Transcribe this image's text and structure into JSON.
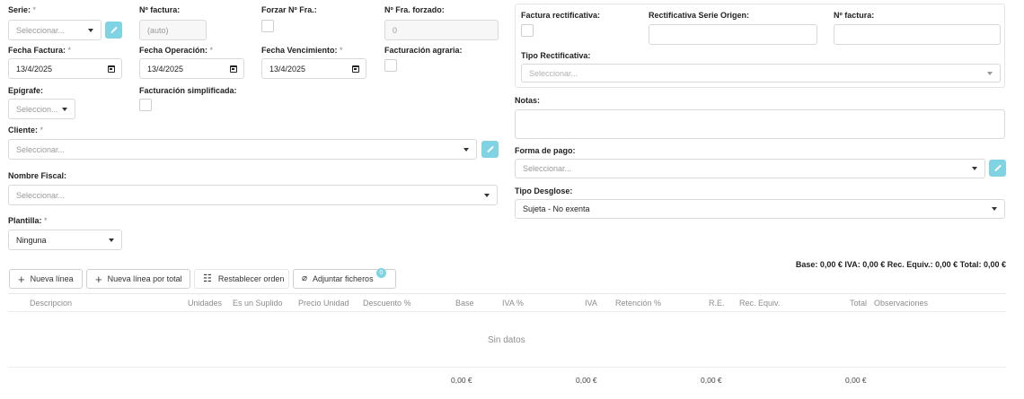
{
  "form": {
    "serie": {
      "label": "Serie:",
      "required": "*",
      "placeholder": "Seleccionar..."
    },
    "numero_factura": {
      "label": "Nº factura:",
      "value": "(auto)"
    },
    "forzar_nfra": {
      "label": "Forzar Nº Fra.:"
    },
    "nfra_forzado": {
      "label": "Nº Fra. forzado:",
      "value": "0"
    },
    "fecha_factura": {
      "label": "Fecha Factura:",
      "required": "*",
      "value": "13/4/2025"
    },
    "fecha_operacion": {
      "label": "Fecha Operación:",
      "required": "*",
      "value": "13/4/2025"
    },
    "fecha_vencimiento": {
      "label": "Fecha Vencimiento:",
      "required": "*",
      "value": "13/4/2025"
    },
    "facturacion_agraria": {
      "label": "Facturación agraria:"
    },
    "epigrafe": {
      "label": "Epígrafe:",
      "placeholder": "Seleccion..."
    },
    "facturacion_simplificada": {
      "label": "Facturación simplificada:"
    },
    "cliente": {
      "label": "Cliente:",
      "required": "*",
      "placeholder": "Seleccionar..."
    },
    "nombre_fiscal": {
      "label": "Nombre Fiscal:",
      "placeholder": "Seleccionar..."
    },
    "plantilla": {
      "label": "Plantilla:",
      "required": "*",
      "value": "Ninguna"
    }
  },
  "rectificativa": {
    "factura_rectificativa": {
      "label": "Factura rectificativa:"
    },
    "serie_origen": {
      "label": "Rectificativa Serie Origen:"
    },
    "numero_factura": {
      "label": "Nº factura:"
    },
    "tipo": {
      "label": "Tipo Rectificativa:",
      "placeholder": "Seleccionar..."
    }
  },
  "notas": {
    "label": "Notas:"
  },
  "forma_pago": {
    "label": "Forma de pago:",
    "placeholder": "Seleccionar..."
  },
  "tipo_desglose": {
    "label": "Tipo Desglose:",
    "value": "Sujeta - No exenta"
  },
  "summary": "Base: 0,00 € IVA: 0,00 € Rec. Equiv.: 0,00 € Total: 0,00 €",
  "toolbar": {
    "nueva_linea": "Nueva línea",
    "nueva_linea_total": "Nueva línea por total",
    "restablecer_orden": "Restablecer orden",
    "adjuntar_ficheros": "Adjuntar ficheros",
    "adjuntar_count": "0"
  },
  "table": {
    "columns": [
      "Descripcion",
      "Unidades",
      "Es un Suplido",
      "Precio Unidad",
      "Descuento %",
      "Base",
      "IVA %",
      "IVA",
      "Retención %",
      "R.E.",
      "Rec. Equiv.",
      "Total",
      "Observaciones"
    ],
    "empty_text": "Sin datos",
    "totals": {
      "base": "0,00 €",
      "iva": "0,00 €",
      "re": "0,00 €",
      "total": "0,00 €"
    }
  },
  "colors": {
    "accent": "#7fd3e2",
    "border": "#d9d9d9"
  }
}
